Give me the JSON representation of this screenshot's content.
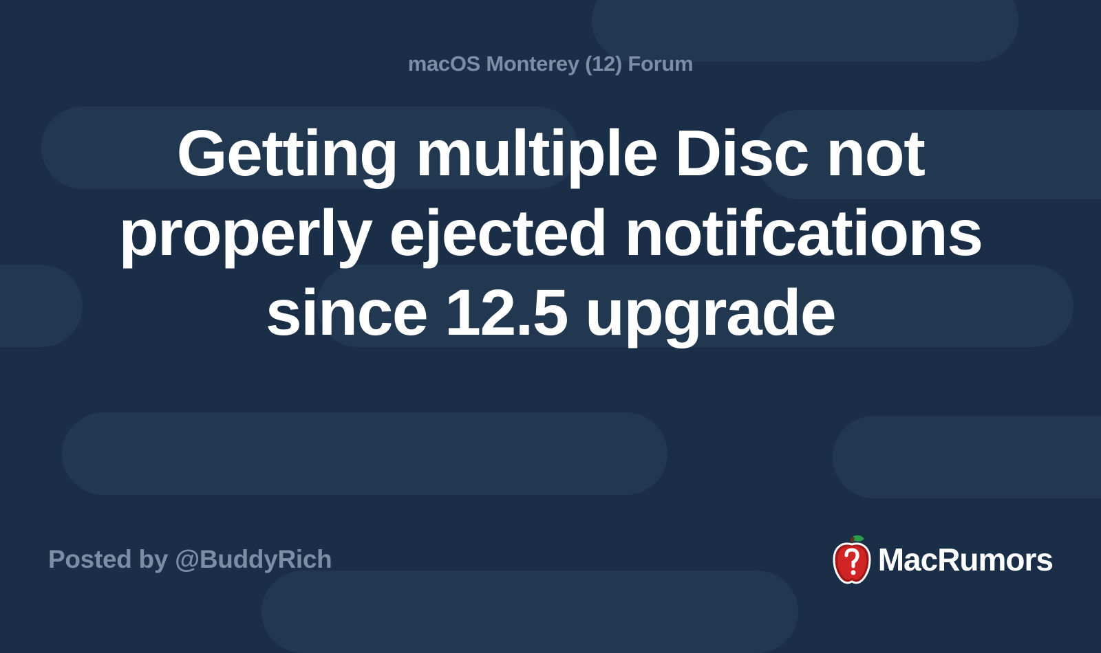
{
  "forum": {
    "name": "macOS Monterey (12) Forum"
  },
  "post": {
    "title": "Getting multiple Disc not properly ejected notifcations since 12.5 upgrade",
    "author_line": "Posted by @BuddyRich"
  },
  "brand": {
    "name": "MacRumors"
  }
}
